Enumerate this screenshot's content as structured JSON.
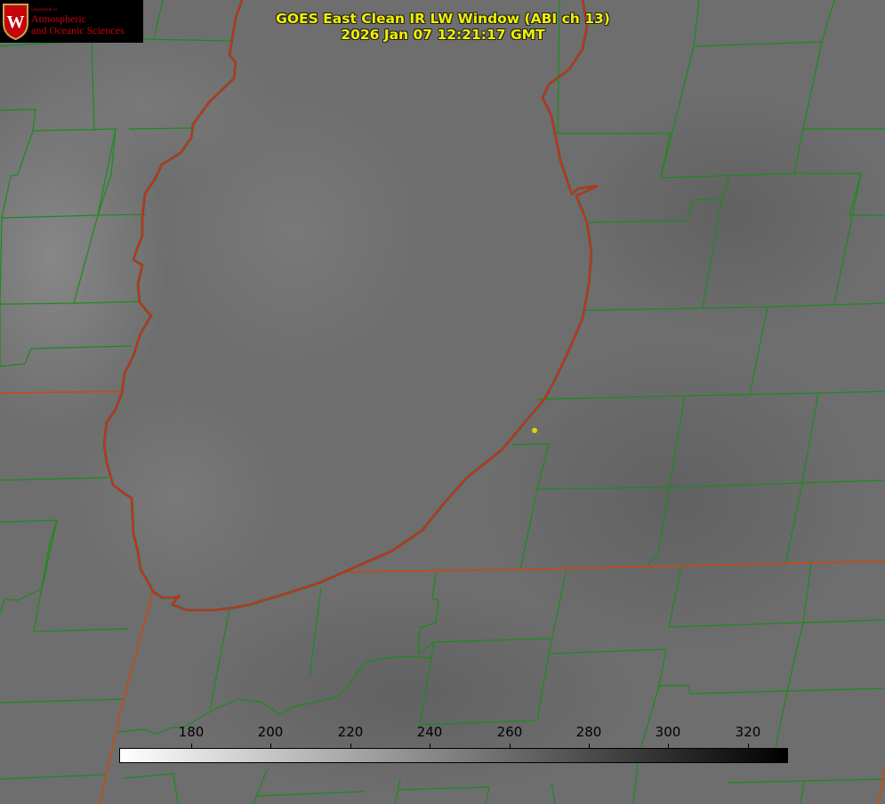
{
  "title": {
    "line1": "GOES East Clean IR LW Window (ABI ch 13)",
    "line2": "2026 Jan 07 12:21:17 GMT"
  },
  "logo": {
    "small": "Department of",
    "line1": "Atmospheric",
    "line2": "and Oceanic Sciences",
    "crest_letter": "W"
  },
  "colorbar": {
    "ticks": [
      "180",
      "200",
      "220",
      "240",
      "260",
      "280",
      "300",
      "320"
    ]
  },
  "colors": {
    "state_border": "#c84a10",
    "county_lines": "#1a8c1a",
    "shoreline": "#ee2020",
    "marker": "#d8d800",
    "title_text": "#f0f000"
  }
}
